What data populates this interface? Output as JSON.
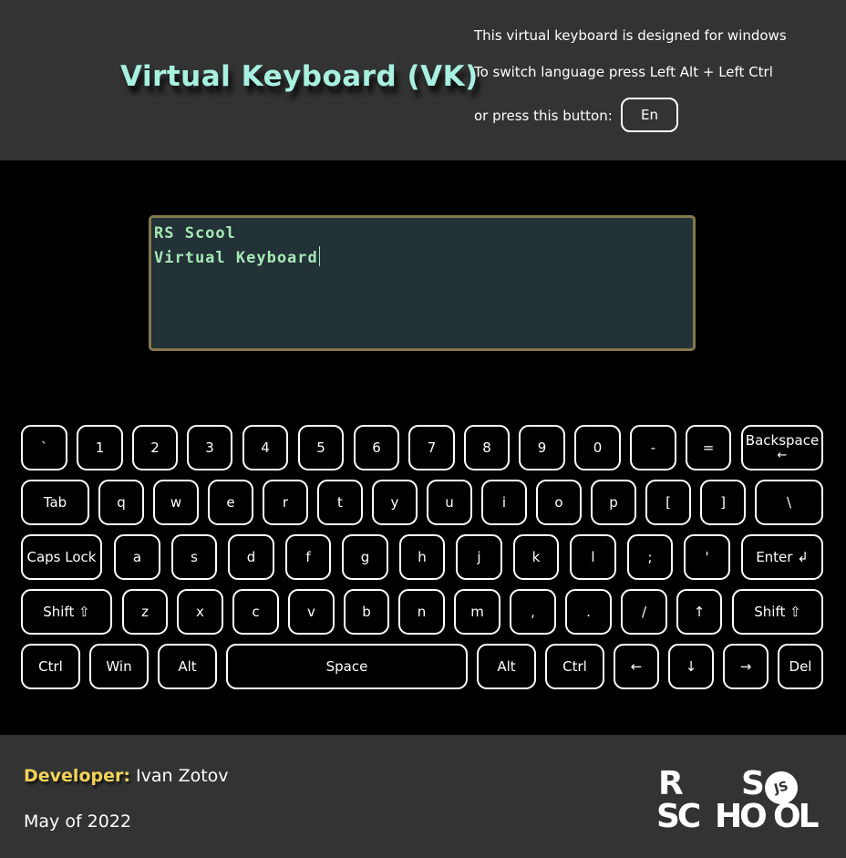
{
  "header": {
    "title": "Virtual Keyboard (VK)",
    "info_line1": "This virtual keyboard is designed for windows",
    "info_line2": "To switch language press Left Alt + Left Ctrl",
    "info_line3": "or press this button:",
    "lang_button": "En"
  },
  "textarea": {
    "line1": "RS Scool",
    "line2": "Virtual Keyboard"
  },
  "keyboard": {
    "row1": [
      "`",
      "1",
      "2",
      "3",
      "4",
      "5",
      "6",
      "7",
      "8",
      "9",
      "0",
      "-",
      "="
    ],
    "backspace": "Backspace",
    "backspace_arrow": "←",
    "row2": [
      "Tab",
      "q",
      "w",
      "e",
      "r",
      "t",
      "y",
      "u",
      "i",
      "o",
      "p",
      "[",
      "]",
      "\\"
    ],
    "row3": [
      "Caps Lock",
      "a",
      "s",
      "d",
      "f",
      "g",
      "h",
      "j",
      "k",
      "l",
      ";",
      "'",
      "Enter ↲"
    ],
    "row4": [
      "Shift ⇧",
      "z",
      "x",
      "c",
      "v",
      "b",
      "n",
      "m",
      ",",
      ".",
      "/",
      "↑",
      "Shift ⇧"
    ],
    "row5": [
      "Ctrl",
      "Win",
      "Alt",
      "Space",
      "Alt",
      "Ctrl",
      "←",
      "↓",
      "→",
      "Del"
    ]
  },
  "footer": {
    "developer_label": "Developer:",
    "developer_name": "Ivan Zotov",
    "date": "May of 2022",
    "logo": {
      "r": "R",
      "s": "S",
      "sc": "SC",
      "ho": "HO",
      "ol": "OL",
      "js": "JS"
    }
  }
}
